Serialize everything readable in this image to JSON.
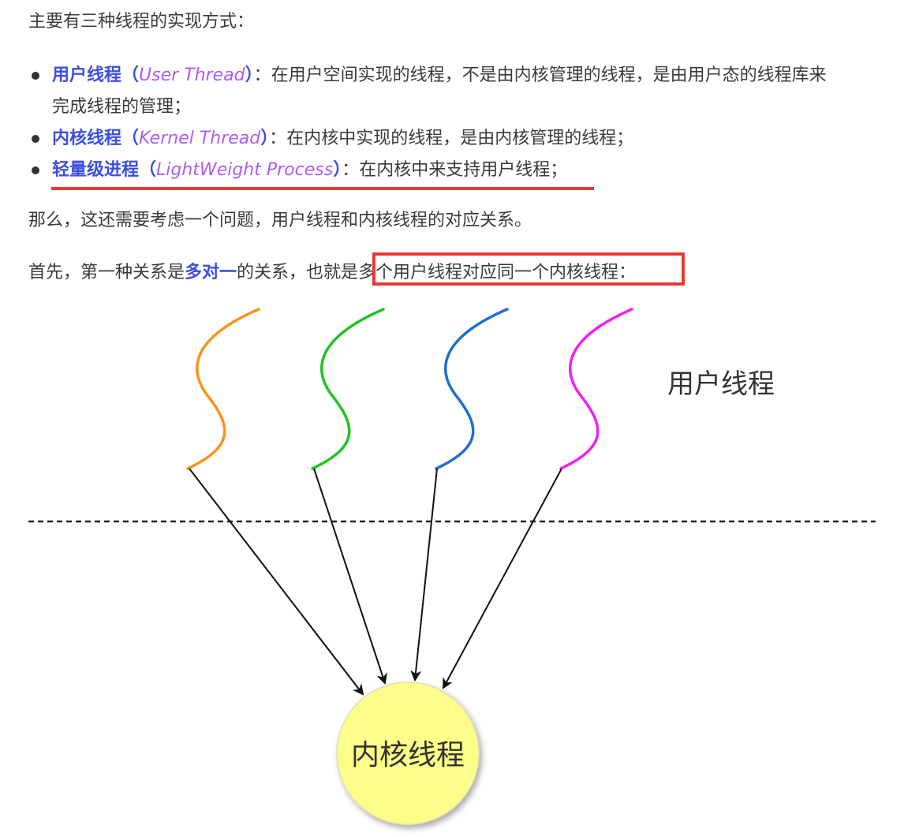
{
  "intro": "主要有三种线程的实现方式：",
  "bullets": [
    {
      "term": "用户线程",
      "open_paren": "（",
      "en": "User Thread",
      "close_paren": "）",
      "desc": "：在用户空间实现的线程，不是由内核管理的线程，是由用户态的线程库来",
      "desc2": "完成线程的管理；"
    },
    {
      "term": "内核线程",
      "open_paren": "（",
      "en": "Kernel Thread",
      "close_paren": "）",
      "desc": "：在内核中实现的线程，是由内核管理的线程；"
    },
    {
      "term": "轻量级进程",
      "open_paren": "（",
      "en": "LightWeight Process",
      "close_paren": "）",
      "desc": "：在内核中来支持用户线程；"
    }
  ],
  "p2": "那么，这还需要考虑一个问题，用户线程和内核线程的对应关系。",
  "p3": {
    "before": "首先，第一种关系是",
    "strong": "多对一",
    "after": "的关系，也就是多个用户线程对应同一个内核线程："
  },
  "diagram": {
    "user_label": "用户线程",
    "kernel_label": "内核线程",
    "thread_colors": [
      "#f7941d",
      "#22c322",
      "#1f6fd0",
      "#ee22ee"
    ],
    "kernel_fill": "#fdfd8a"
  }
}
